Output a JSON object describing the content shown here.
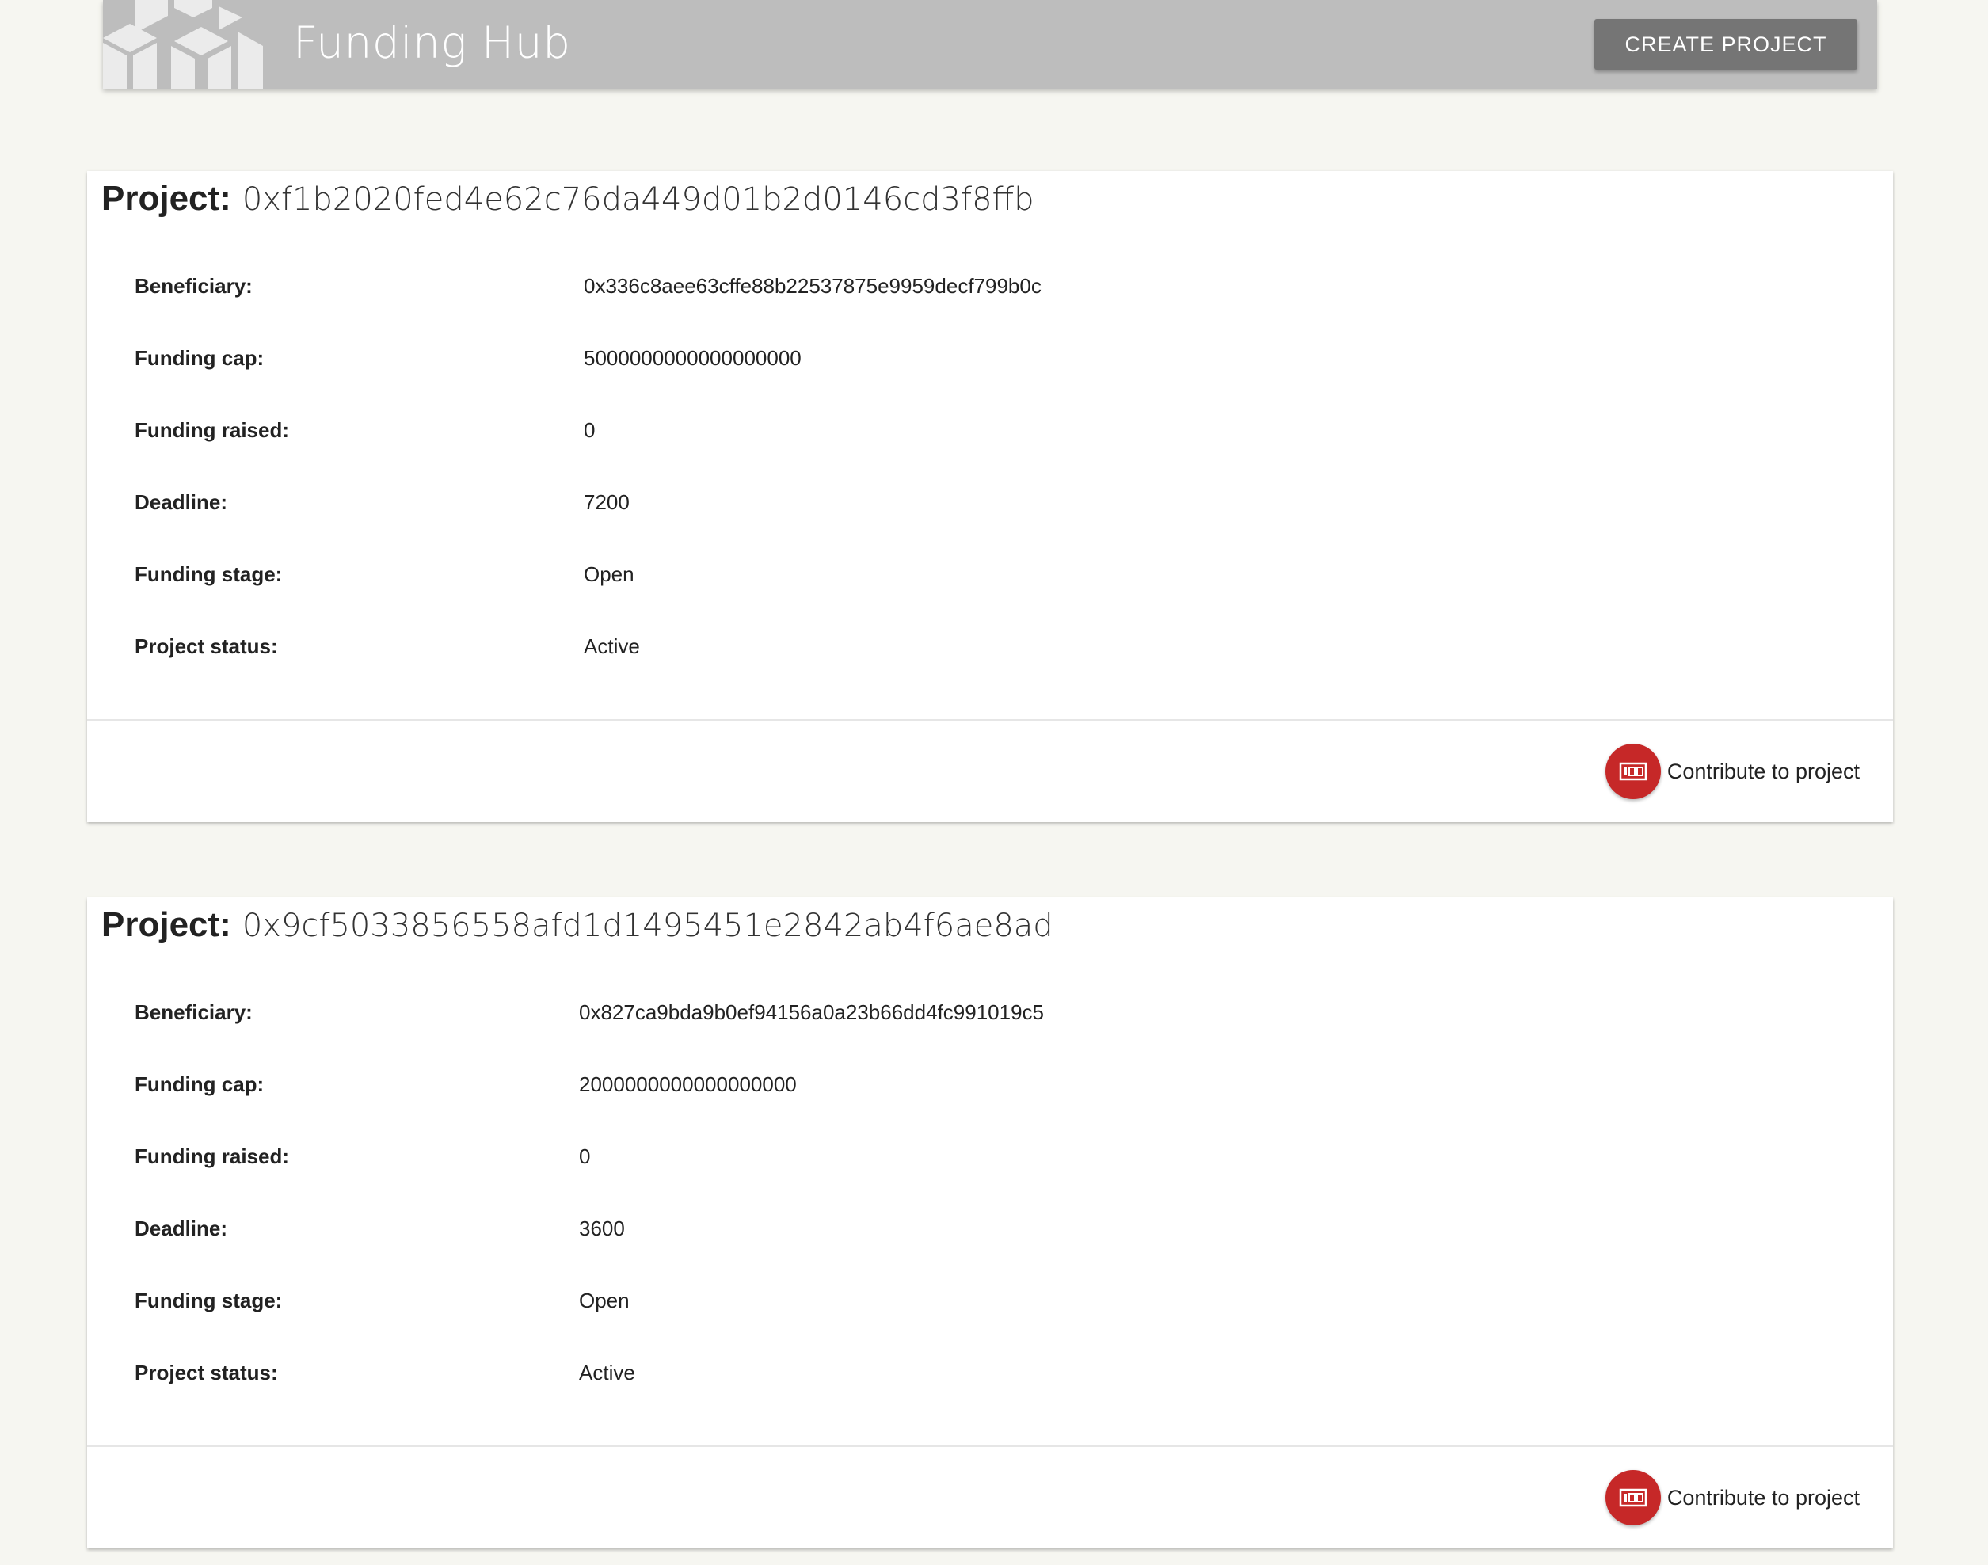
{
  "app": {
    "title": "Funding Hub",
    "create_button_label": "CREATE PROJECT",
    "logo_icon": "cubes-logo-icon"
  },
  "colors": {
    "background": "#f6f6f1",
    "appbar": "#bdbdbd",
    "button": "#757575",
    "accent": "#c62828",
    "card": "#ffffff"
  },
  "projects": [
    {
      "title_label": "Project:",
      "id": "0xf1b2020fed4e62c76da449d01b2d0146cd3f8ffb",
      "fields": [
        {
          "label": "Beneficiary:",
          "value": "0x336c8aee63cffe88b22537875e9959decf799b0c"
        },
        {
          "label": "Funding cap:",
          "value": "5000000000000000000"
        },
        {
          "label": "Funding raised:",
          "value": "0"
        },
        {
          "label": "Deadline:",
          "value": "7200"
        },
        {
          "label": "Funding stage:",
          "value": "Open"
        },
        {
          "label": "Project status:",
          "value": "Active"
        }
      ],
      "contribute_label": "Contribute to project",
      "contribute_icon": "money-icon"
    },
    {
      "title_label": "Project:",
      "id": "0x9cf5033856558afd1d1495451e2842ab4f6ae8ad",
      "fields": [
        {
          "label": "Beneficiary:",
          "value": "0x827ca9bda9b0ef94156a0a23b66dd4fc991019c5"
        },
        {
          "label": "Funding cap:",
          "value": "2000000000000000000"
        },
        {
          "label": "Funding raised:",
          "value": "0"
        },
        {
          "label": "Deadline:",
          "value": "3600"
        },
        {
          "label": "Funding stage:",
          "value": "Open"
        },
        {
          "label": "Project status:",
          "value": "Active"
        }
      ],
      "contribute_label": "Contribute to project",
      "contribute_icon": "money-icon"
    }
  ]
}
